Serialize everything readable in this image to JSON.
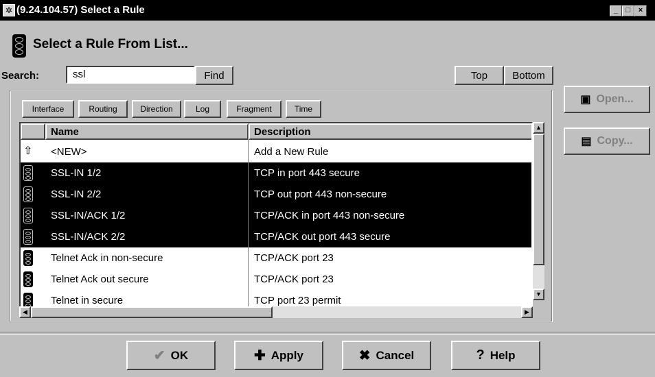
{
  "window": {
    "title": "(9.24.104.57) Select a Rule",
    "min": "_",
    "max": "□",
    "close": "×"
  },
  "header": {
    "title": "Select a Rule From List..."
  },
  "search": {
    "label": "Search:",
    "value": "ssl",
    "find": "Find",
    "top": "Top",
    "bottom": "Bottom"
  },
  "side": {
    "open": "Open...",
    "copy": "Copy..."
  },
  "filters": [
    "Interface",
    "Routing",
    "Direction",
    "Log",
    "Fragment",
    "Time"
  ],
  "table": {
    "columns": [
      "Name",
      "Description"
    ],
    "rows": [
      {
        "name": "<NEW>",
        "desc": "Add a New Rule",
        "icon": "new-rule-icon",
        "selected": false
      },
      {
        "name": "SSL-IN 1/2",
        "desc": "TCP in port 443 secure",
        "icon": "traffic-light-icon",
        "selected": true
      },
      {
        "name": "SSL-IN 2/2",
        "desc": "TCP out port 443 non-secure",
        "icon": "traffic-light-icon",
        "selected": true
      },
      {
        "name": "SSL-IN/ACK 1/2",
        "desc": "TCP/ACK in port 443 non-secure",
        "icon": "traffic-light-icon",
        "selected": true
      },
      {
        "name": "SSL-IN/ACK 2/2",
        "desc": "TCP/ACK out port 443 secure",
        "icon": "traffic-light-icon",
        "selected": true
      },
      {
        "name": "Telnet Ack in non-secure",
        "desc": "TCP/ACK port 23",
        "icon": "traffic-light-icon",
        "selected": false
      },
      {
        "name": "Telnet Ack out secure",
        "desc": "TCP/ACK port 23",
        "icon": "traffic-light-icon",
        "selected": false
      },
      {
        "name": "Telnet in secure",
        "desc": "TCP port 23 permit",
        "icon": "traffic-light-icon",
        "selected": false
      }
    ]
  },
  "buttons": {
    "ok": "OK",
    "apply": "Apply",
    "cancel": "Cancel",
    "help": "Help"
  },
  "colors": {
    "face": "#c0c0c0",
    "selection": "#000000",
    "disabled": "#808080"
  }
}
